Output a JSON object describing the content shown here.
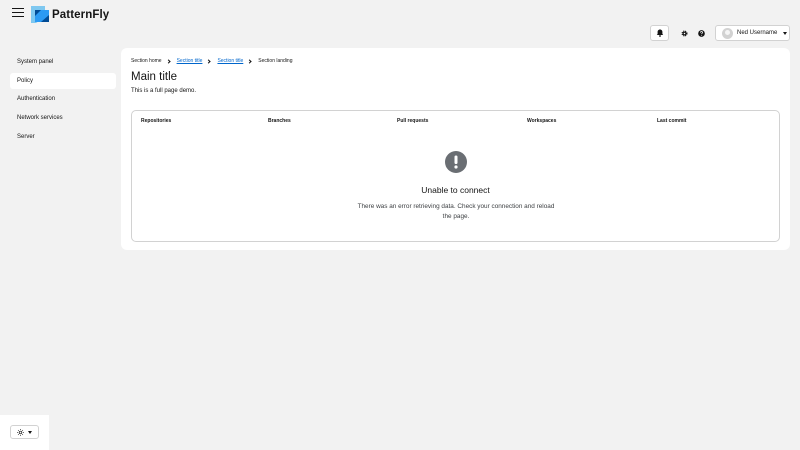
{
  "masthead": {
    "brand": "PatternFly",
    "user_name": "Ned Username"
  },
  "sidebar": {
    "items": [
      {
        "label": "System panel"
      },
      {
        "label": "Policy"
      },
      {
        "label": "Authentication"
      },
      {
        "label": "Network services"
      },
      {
        "label": "Server"
      }
    ],
    "active_index": 1
  },
  "breadcrumb": [
    "Section home",
    "Section title",
    "Section title",
    "Section landing"
  ],
  "page": {
    "title": "Main title",
    "description": "This is a full page demo."
  },
  "table": {
    "columns": [
      "Repositories",
      "Branches",
      "Pull requests",
      "Workspaces",
      "Last commit"
    ]
  },
  "empty_state": {
    "title": "Unable to connect",
    "body": "There was an error retrieving data. Check your connection and reload the page."
  },
  "colors": {
    "link": "#0066cc",
    "background": "#f2f2f2",
    "icon_gray": "#6a6e73"
  }
}
